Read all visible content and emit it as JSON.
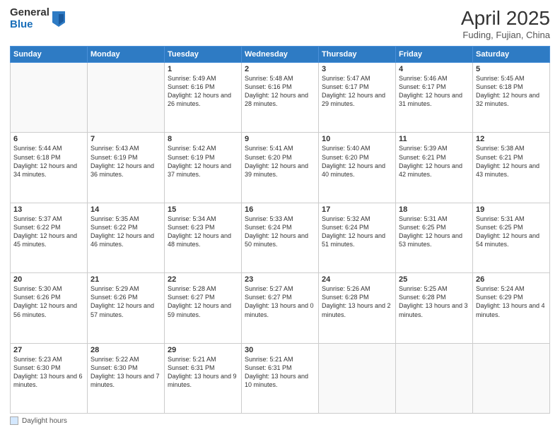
{
  "logo": {
    "general": "General",
    "blue": "Blue"
  },
  "title": "April 2025",
  "subtitle": "Fuding, Fujian, China",
  "days_of_week": [
    "Sunday",
    "Monday",
    "Tuesday",
    "Wednesday",
    "Thursday",
    "Friday",
    "Saturday"
  ],
  "footer_label": "Daylight hours",
  "weeks": [
    [
      {
        "day": "",
        "info": ""
      },
      {
        "day": "",
        "info": ""
      },
      {
        "day": "1",
        "info": "Sunrise: 5:49 AM\nSunset: 6:16 PM\nDaylight: 12 hours and 26 minutes."
      },
      {
        "day": "2",
        "info": "Sunrise: 5:48 AM\nSunset: 6:16 PM\nDaylight: 12 hours and 28 minutes."
      },
      {
        "day": "3",
        "info": "Sunrise: 5:47 AM\nSunset: 6:17 PM\nDaylight: 12 hours and 29 minutes."
      },
      {
        "day": "4",
        "info": "Sunrise: 5:46 AM\nSunset: 6:17 PM\nDaylight: 12 hours and 31 minutes."
      },
      {
        "day": "5",
        "info": "Sunrise: 5:45 AM\nSunset: 6:18 PM\nDaylight: 12 hours and 32 minutes."
      }
    ],
    [
      {
        "day": "6",
        "info": "Sunrise: 5:44 AM\nSunset: 6:18 PM\nDaylight: 12 hours and 34 minutes."
      },
      {
        "day": "7",
        "info": "Sunrise: 5:43 AM\nSunset: 6:19 PM\nDaylight: 12 hours and 36 minutes."
      },
      {
        "day": "8",
        "info": "Sunrise: 5:42 AM\nSunset: 6:19 PM\nDaylight: 12 hours and 37 minutes."
      },
      {
        "day": "9",
        "info": "Sunrise: 5:41 AM\nSunset: 6:20 PM\nDaylight: 12 hours and 39 minutes."
      },
      {
        "day": "10",
        "info": "Sunrise: 5:40 AM\nSunset: 6:20 PM\nDaylight: 12 hours and 40 minutes."
      },
      {
        "day": "11",
        "info": "Sunrise: 5:39 AM\nSunset: 6:21 PM\nDaylight: 12 hours and 42 minutes."
      },
      {
        "day": "12",
        "info": "Sunrise: 5:38 AM\nSunset: 6:21 PM\nDaylight: 12 hours and 43 minutes."
      }
    ],
    [
      {
        "day": "13",
        "info": "Sunrise: 5:37 AM\nSunset: 6:22 PM\nDaylight: 12 hours and 45 minutes."
      },
      {
        "day": "14",
        "info": "Sunrise: 5:35 AM\nSunset: 6:22 PM\nDaylight: 12 hours and 46 minutes."
      },
      {
        "day": "15",
        "info": "Sunrise: 5:34 AM\nSunset: 6:23 PM\nDaylight: 12 hours and 48 minutes."
      },
      {
        "day": "16",
        "info": "Sunrise: 5:33 AM\nSunset: 6:24 PM\nDaylight: 12 hours and 50 minutes."
      },
      {
        "day": "17",
        "info": "Sunrise: 5:32 AM\nSunset: 6:24 PM\nDaylight: 12 hours and 51 minutes."
      },
      {
        "day": "18",
        "info": "Sunrise: 5:31 AM\nSunset: 6:25 PM\nDaylight: 12 hours and 53 minutes."
      },
      {
        "day": "19",
        "info": "Sunrise: 5:31 AM\nSunset: 6:25 PM\nDaylight: 12 hours and 54 minutes."
      }
    ],
    [
      {
        "day": "20",
        "info": "Sunrise: 5:30 AM\nSunset: 6:26 PM\nDaylight: 12 hours and 56 minutes."
      },
      {
        "day": "21",
        "info": "Sunrise: 5:29 AM\nSunset: 6:26 PM\nDaylight: 12 hours and 57 minutes."
      },
      {
        "day": "22",
        "info": "Sunrise: 5:28 AM\nSunset: 6:27 PM\nDaylight: 12 hours and 59 minutes."
      },
      {
        "day": "23",
        "info": "Sunrise: 5:27 AM\nSunset: 6:27 PM\nDaylight: 13 hours and 0 minutes."
      },
      {
        "day": "24",
        "info": "Sunrise: 5:26 AM\nSunset: 6:28 PM\nDaylight: 13 hours and 2 minutes."
      },
      {
        "day": "25",
        "info": "Sunrise: 5:25 AM\nSunset: 6:28 PM\nDaylight: 13 hours and 3 minutes."
      },
      {
        "day": "26",
        "info": "Sunrise: 5:24 AM\nSunset: 6:29 PM\nDaylight: 13 hours and 4 minutes."
      }
    ],
    [
      {
        "day": "27",
        "info": "Sunrise: 5:23 AM\nSunset: 6:30 PM\nDaylight: 13 hours and 6 minutes."
      },
      {
        "day": "28",
        "info": "Sunrise: 5:22 AM\nSunset: 6:30 PM\nDaylight: 13 hours and 7 minutes."
      },
      {
        "day": "29",
        "info": "Sunrise: 5:21 AM\nSunset: 6:31 PM\nDaylight: 13 hours and 9 minutes."
      },
      {
        "day": "30",
        "info": "Sunrise: 5:21 AM\nSunset: 6:31 PM\nDaylight: 13 hours and 10 minutes."
      },
      {
        "day": "",
        "info": ""
      },
      {
        "day": "",
        "info": ""
      },
      {
        "day": "",
        "info": ""
      }
    ]
  ]
}
